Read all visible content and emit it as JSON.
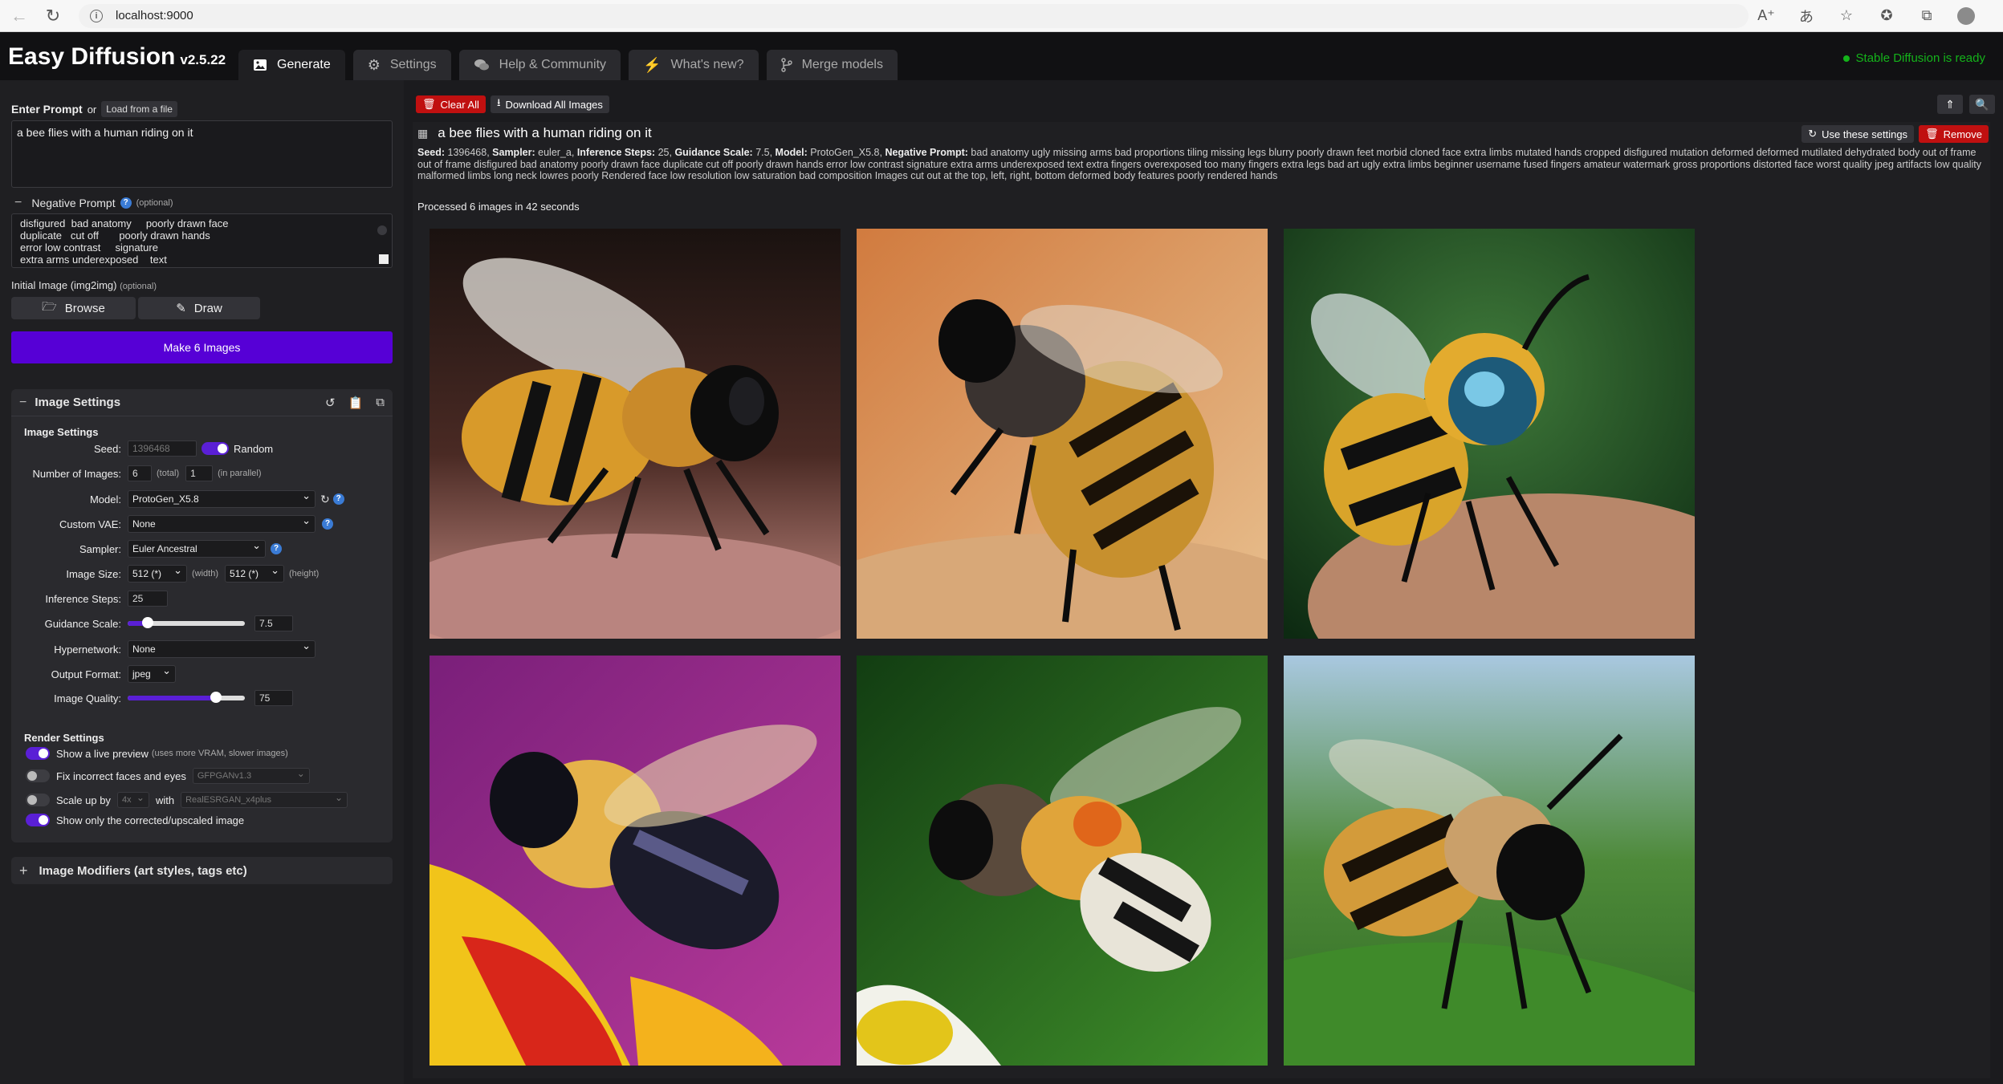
{
  "browser": {
    "url": "localhost:9000"
  },
  "app": {
    "name": "Easy Diffusion",
    "version": "v2.5.22",
    "status": "Stable Diffusion is ready"
  },
  "tabs": [
    {
      "label": "Generate",
      "icon": "image-icon"
    },
    {
      "label": "Settings",
      "icon": "gear-icon"
    },
    {
      "label": "Help & Community",
      "icon": "comments-icon"
    },
    {
      "label": "What's new?",
      "icon": "bolt-icon"
    },
    {
      "label": "Merge models",
      "icon": "code-fork-icon"
    }
  ],
  "prompt": {
    "label": "Enter Prompt",
    "or": "or",
    "load_label": "Load from a file",
    "value": "a bee flies with a human riding on it",
    "negative_label": "Negative Prompt",
    "negative_optional": "(optional)",
    "negative_lines": [
      "disfigured  bad anatomy     poorly drawn face",
      "duplicate   cut off       poorly drawn hands",
      "error low contrast     signature",
      "extra arms underexposed    text"
    ],
    "initial_label": "Initial Image (img2img)",
    "initial_optional": "(optional)",
    "browse_label": "Browse",
    "draw_label": "Draw",
    "make_label": "Make 6 Images"
  },
  "image_settings": {
    "panel_title": "Image Settings",
    "section_title": "Image Settings",
    "seed_label": "Seed:",
    "seed_value": "1396468",
    "random_label": "Random",
    "num_label": "Number of Images:",
    "num_total": "6",
    "num_total_hint": "(total)",
    "num_parallel": "1",
    "num_parallel_hint": "(in parallel)",
    "model_label": "Model:",
    "model_value": "ProtoGen_X5.8",
    "vae_label": "Custom VAE:",
    "vae_value": "None",
    "sampler_label": "Sampler:",
    "sampler_value": "Euler Ancestral",
    "size_label": "Image Size:",
    "width_value": "512 (*)",
    "width_hint": "(width)",
    "height_value": "512 (*)",
    "height_hint": "(height)",
    "steps_label": "Inference Steps:",
    "steps_value": "25",
    "guidance_label": "Guidance Scale:",
    "guidance_value": "7.5",
    "guidance_fraction": 0.17,
    "hypernetwork_label": "Hypernetwork:",
    "hypernetwork_value": "None",
    "format_label": "Output Format:",
    "format_value": "jpeg",
    "quality_label": "Image Quality:",
    "quality_value": "75",
    "quality_fraction": 0.75
  },
  "render_settings": {
    "title": "Render Settings",
    "live_preview": "Show a live preview",
    "live_preview_hint": "(uses more VRAM, slower images)",
    "fix_faces": "Fix incorrect faces and eyes",
    "fix_faces_model": "GFPGANv1.3",
    "scale_label": "Scale up by",
    "scale_value": "4x",
    "scale_with": "with",
    "scale_model": "RealESRGAN_x4plus",
    "show_only": "Show only the corrected/upscaled image"
  },
  "modifiers": {
    "label": "Image Modifiers (art styles, tags etc)"
  },
  "toolbar": {
    "clear_all": "Clear All",
    "download_all": "Download All Images"
  },
  "task": {
    "title": "a bee flies with a human riding on it",
    "use_settings": "Use these settings",
    "remove": "Remove",
    "meta": [
      {
        "k": "Seed:",
        "v": "1396468,"
      },
      {
        "k": "Sampler:",
        "v": "euler_a,"
      },
      {
        "k": "Inference Steps:",
        "v": "25,"
      },
      {
        "k": "Guidance Scale:",
        "v": "7.5,"
      },
      {
        "k": "Model:",
        "v": "ProtoGen_X5.8,"
      },
      {
        "k": "Negative Prompt:",
        "v": "bad anatomy ugly missing arms bad proportions tiling missing legs blurry poorly drawn feet morbid cloned face extra limbs mutated hands cropped disfigured mutation deformed deformed mutilated dehydrated body out of frame out of frame disfigured bad anatomy poorly drawn face duplicate cut off poorly drawn hands error low contrast signature extra arms underexposed text extra fingers overexposed too many fingers extra legs bad art ugly extra limbs beginner username fused fingers amateur watermark gross proportions distorted face worst quality jpeg artifacts low quality malformed limbs long neck lowres poorly Rendered face low resolution low saturation bad composition Images cut out at the top, left, right, bottom deformed body features poorly rendered hands"
      }
    ],
    "processed": "Processed 6 images in 42 seconds"
  }
}
